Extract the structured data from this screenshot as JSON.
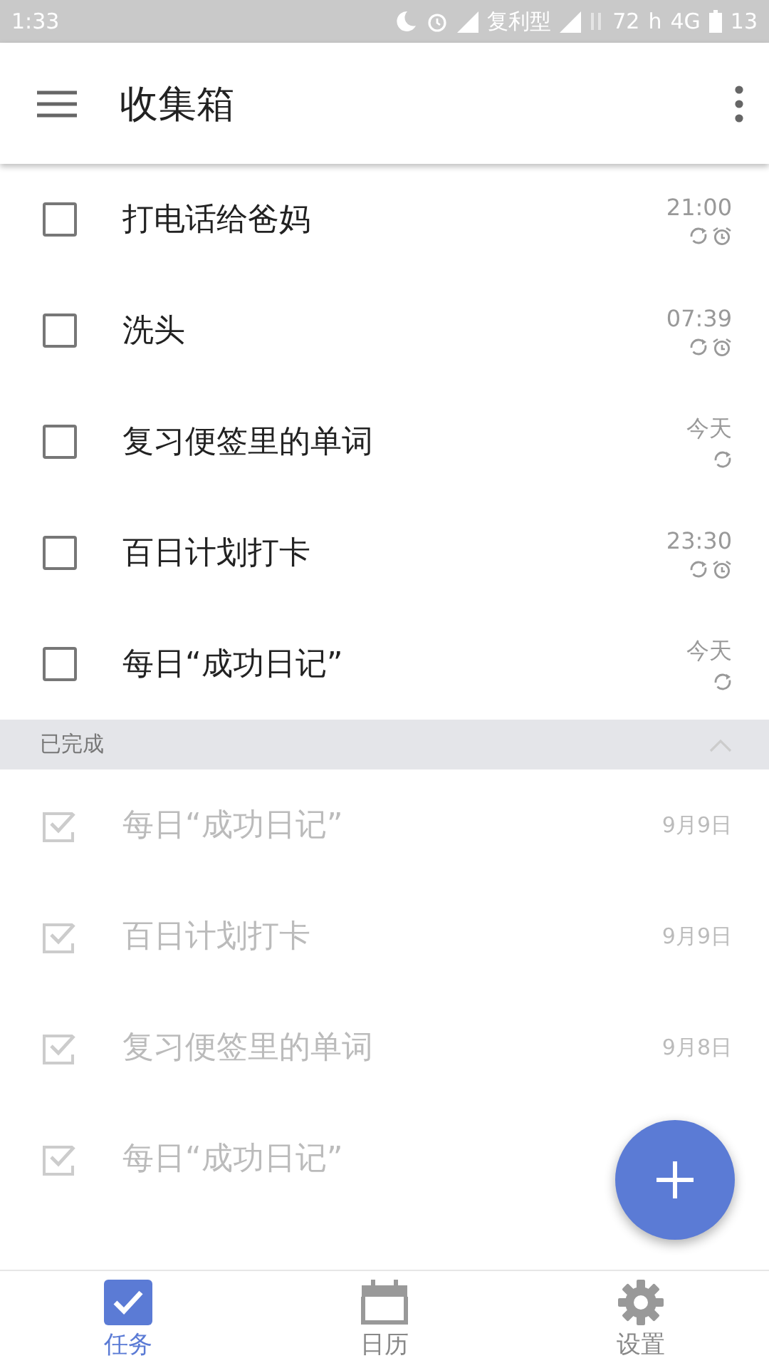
{
  "status_bar": {
    "time": "1:33",
    "carrier": "复利型",
    "speed": "72",
    "speed_unit": "h",
    "network": "4G",
    "battery": "13"
  },
  "header": {
    "title": "收集箱"
  },
  "tasks": [
    {
      "title": "打电话给爸妈",
      "due": "21:00",
      "repeat": true,
      "alarm": true,
      "checked": false
    },
    {
      "title": "洗头",
      "due": "07:39",
      "repeat": true,
      "alarm": true,
      "checked": false
    },
    {
      "title": "复习便签里的单词",
      "due": "今天",
      "repeat": true,
      "alarm": false,
      "checked": false
    },
    {
      "title": "百日计划打卡",
      "due": "23:30",
      "repeat": true,
      "alarm": true,
      "checked": false
    },
    {
      "title": "每日“成功日记”",
      "due": "今天",
      "repeat": true,
      "alarm": false,
      "checked": false
    }
  ],
  "completed_section": {
    "label": "已完成",
    "expanded": true
  },
  "completed": [
    {
      "title": "每日“成功日记”",
      "date": "9月9日",
      "checked": true
    },
    {
      "title": "百日计划打卡",
      "date": "9月9日",
      "checked": true
    },
    {
      "title": "复习便签里的单词",
      "date": "9月8日",
      "checked": true
    },
    {
      "title": "每日“成功日记”",
      "checked": true
    }
  ],
  "bottom_nav": [
    {
      "label": "任务",
      "kind": "tasks",
      "selected": true
    },
    {
      "label": "日历",
      "kind": "calendar",
      "selected": false
    },
    {
      "label": "设置",
      "kind": "settings",
      "selected": false
    }
  ]
}
